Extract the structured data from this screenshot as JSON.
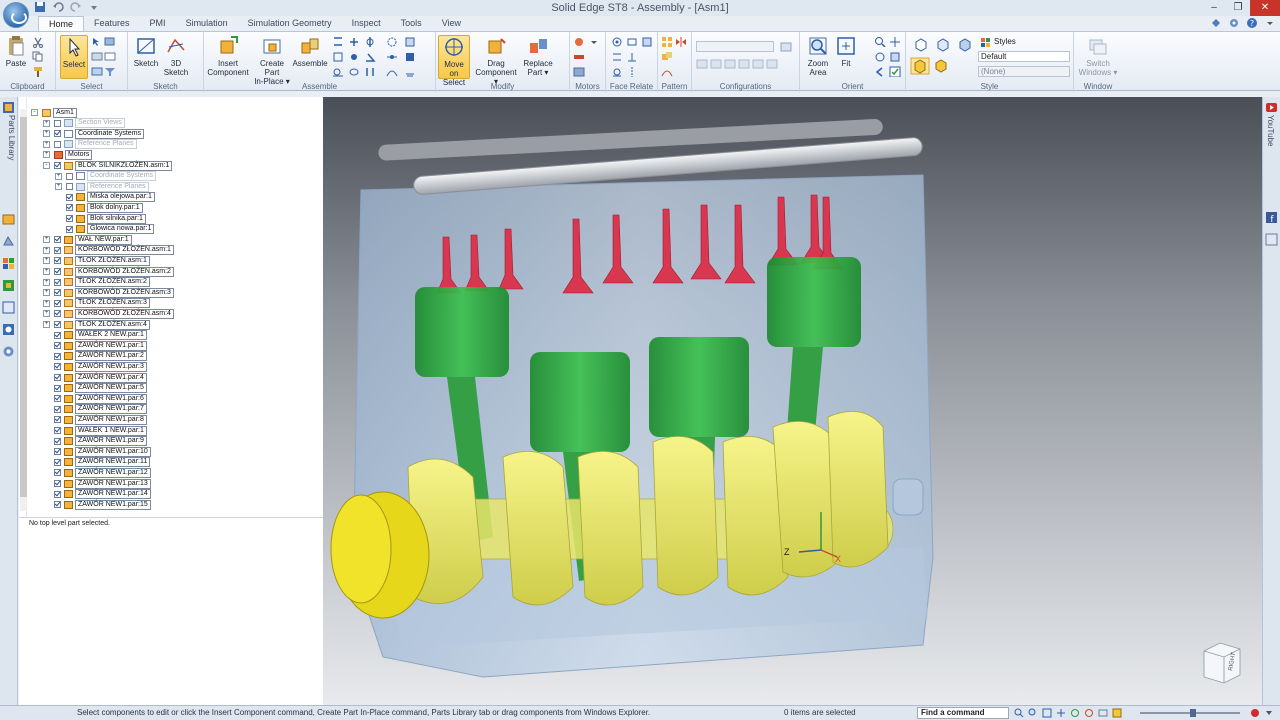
{
  "window": {
    "title": "Solid Edge ST8 - Assembly - [Asm1]"
  },
  "tabs": [
    {
      "label": "Home",
      "active": true
    },
    {
      "label": "Features"
    },
    {
      "label": "PMI"
    },
    {
      "label": "Simulation"
    },
    {
      "label": "Simulation Geometry"
    },
    {
      "label": "Inspect"
    },
    {
      "label": "Tools"
    },
    {
      "label": "View"
    }
  ],
  "ribbon": {
    "groups": {
      "clipboard": "Clipboard",
      "select": "Select",
      "sketch": "Sketch",
      "assemble": "Assemble",
      "modify": "Modify",
      "motors": "Motors",
      "face_relate": "Face Relate",
      "pattern": "Pattern",
      "configurations": "Configurations",
      "orient": "Orient",
      "style": "Style",
      "window": "Window"
    },
    "buttons": {
      "paste": "Paste",
      "select": "Select",
      "sketch": "Sketch",
      "sketch3d_1": "3D",
      "sketch3d_2": "Sketch",
      "insert_1": "Insert",
      "insert_2": "Component",
      "create_1": "Create Part",
      "create_2": "In-Place ▾",
      "assemble": "Assemble",
      "move_1": "Move on",
      "move_2": "Select",
      "drag_1": "Drag",
      "drag_2": "Component ▾",
      "replace_1": "Replace",
      "replace_2": "Part ▾",
      "zoom_1": "Zoom",
      "zoom_2": "Area",
      "fit": "Fit",
      "switch_1": "Switch",
      "switch_2": "Windows ▾"
    },
    "styles": {
      "label": "Styles",
      "value": "Default",
      "value2": "(None)"
    }
  },
  "left_strip": {
    "parts_library": "Parts Library"
  },
  "right_strip": {
    "youtube": "YouTube"
  },
  "tree": [
    {
      "label": "Asm1",
      "level": 0,
      "exp": "-",
      "check": null,
      "icon": "asm"
    },
    {
      "label": "Section Views",
      "level": 1,
      "exp": "+",
      "check": false,
      "icon": "ref",
      "dim": true
    },
    {
      "label": "Coordinate Systems",
      "level": 1,
      "exp": "+",
      "check": true,
      "icon": "cs"
    },
    {
      "label": "Reference Planes",
      "level": 1,
      "exp": "+",
      "check": false,
      "icon": "ref",
      "dim": true
    },
    {
      "label": "Motors",
      "level": 1,
      "exp": "+",
      "check": null,
      "icon": "mot"
    },
    {
      "label": "BLOK SILNIKZŁOŻEN.asm:1",
      "level": 1,
      "exp": "-",
      "check": true,
      "icon": "asm"
    },
    {
      "label": "Coordinate Systems",
      "level": 2,
      "exp": "+",
      "check": false,
      "icon": "cs",
      "dim": true
    },
    {
      "label": "Reference Planes",
      "level": 2,
      "exp": "+",
      "check": false,
      "icon": "ref",
      "dim": true
    },
    {
      "label": "Miska olejowa.par:1",
      "level": 2,
      "exp": "",
      "check": true,
      "icon": "part"
    },
    {
      "label": "Blok dolny.par:1",
      "level": 2,
      "exp": "",
      "check": true,
      "icon": "part"
    },
    {
      "label": "Blok silnika.par:1",
      "level": 2,
      "exp": "",
      "check": true,
      "icon": "part"
    },
    {
      "label": "Glowica nowa.par:1",
      "level": 2,
      "exp": "",
      "check": true,
      "icon": "part"
    },
    {
      "label": "WAŁ NEW.par:1",
      "level": 1,
      "exp": "+",
      "check": true,
      "icon": "part"
    },
    {
      "label": "KORBOWÓD ZŁOŻEN.asm:1",
      "level": 1,
      "exp": "+",
      "check": true,
      "icon": "asm"
    },
    {
      "label": "TŁOK ZŁOŻEN.asm:1",
      "level": 1,
      "exp": "+",
      "check": true,
      "icon": "asm"
    },
    {
      "label": "KORBOWÓD ZŁOŻEN.asm:2",
      "level": 1,
      "exp": "+",
      "check": true,
      "icon": "asm"
    },
    {
      "label": "TŁOK ZŁOŻEN.asm:2",
      "level": 1,
      "exp": "+",
      "check": true,
      "icon": "asm"
    },
    {
      "label": "KORBOWÓD ZŁOŻEN.asm:3",
      "level": 1,
      "exp": "+",
      "check": true,
      "icon": "asm"
    },
    {
      "label": "TŁOK ZŁOŻEN.asm:3",
      "level": 1,
      "exp": "+",
      "check": true,
      "icon": "asm"
    },
    {
      "label": "KORBOWÓD ZŁOŻEN.asm:4",
      "level": 1,
      "exp": "+",
      "check": true,
      "icon": "asm"
    },
    {
      "label": "TŁOK ZŁOŻEN.asm:4",
      "level": 1,
      "exp": "+",
      "check": true,
      "icon": "asm"
    },
    {
      "label": "WAŁEK 2 NEW.par:1",
      "level": 1,
      "exp": "",
      "check": true,
      "icon": "part"
    },
    {
      "label": "ZAWÓR NEW1.par:1",
      "level": 1,
      "exp": "",
      "check": true,
      "icon": "part"
    },
    {
      "label": "ZAWÓR NEW1.par:2",
      "level": 1,
      "exp": "",
      "check": true,
      "icon": "part"
    },
    {
      "label": "ZAWÓR NEW1.par:3",
      "level": 1,
      "exp": "",
      "check": true,
      "icon": "part"
    },
    {
      "label": "ZAWÓR NEW1.par:4",
      "level": 1,
      "exp": "",
      "check": true,
      "icon": "part"
    },
    {
      "label": "ZAWÓR NEW1.par:5",
      "level": 1,
      "exp": "",
      "check": true,
      "icon": "part"
    },
    {
      "label": "ZAWÓR NEW1.par:6",
      "level": 1,
      "exp": "",
      "check": true,
      "icon": "part"
    },
    {
      "label": "ZAWÓR NEW1.par:7",
      "level": 1,
      "exp": "",
      "check": true,
      "icon": "part"
    },
    {
      "label": "ZAWÓR NEW1.par:8",
      "level": 1,
      "exp": "",
      "check": true,
      "icon": "part"
    },
    {
      "label": "WAŁEK 1 NEW.par:1",
      "level": 1,
      "exp": "",
      "check": true,
      "icon": "part"
    },
    {
      "label": "ZAWÓR NEW1.par:9",
      "level": 1,
      "exp": "",
      "check": true,
      "icon": "part"
    },
    {
      "label": "ZAWÓR NEW1.par:10",
      "level": 1,
      "exp": "",
      "check": true,
      "icon": "part"
    },
    {
      "label": "ZAWÓR NEW1.par:11",
      "level": 1,
      "exp": "",
      "check": true,
      "icon": "part"
    },
    {
      "label": "ZAWÓR NEW1.par:12",
      "level": 1,
      "exp": "",
      "check": true,
      "icon": "part"
    },
    {
      "label": "ZAWÓR NEW1.par:13",
      "level": 1,
      "exp": "",
      "check": true,
      "icon": "part"
    },
    {
      "label": "ZAWÓR NEW1.par:14",
      "level": 1,
      "exp": "",
      "check": true,
      "icon": "part"
    },
    {
      "label": "ZAWÓR NEW1.par:15",
      "level": 1,
      "exp": "",
      "check": true,
      "icon": "part"
    }
  ],
  "pathfinder_status": "No top level part selected.",
  "viewport": {
    "triad": {
      "z": "Z",
      "x": "X"
    },
    "view_cube": "RIGHT"
  },
  "status": {
    "message": "Select components to edit or click the Insert Component command, Create Part In-Place command, Parts Library tab or drag components from Windows Explorer.",
    "selection": "0 items are selected",
    "find_command": "Find a command"
  },
  "colors": {
    "block": "#a9c4e0",
    "piston_green": "#27a83c",
    "crank_yellow": "#e8e66a",
    "valve_red": "#d9364f",
    "cam_gray": "#9a9ea4"
  }
}
